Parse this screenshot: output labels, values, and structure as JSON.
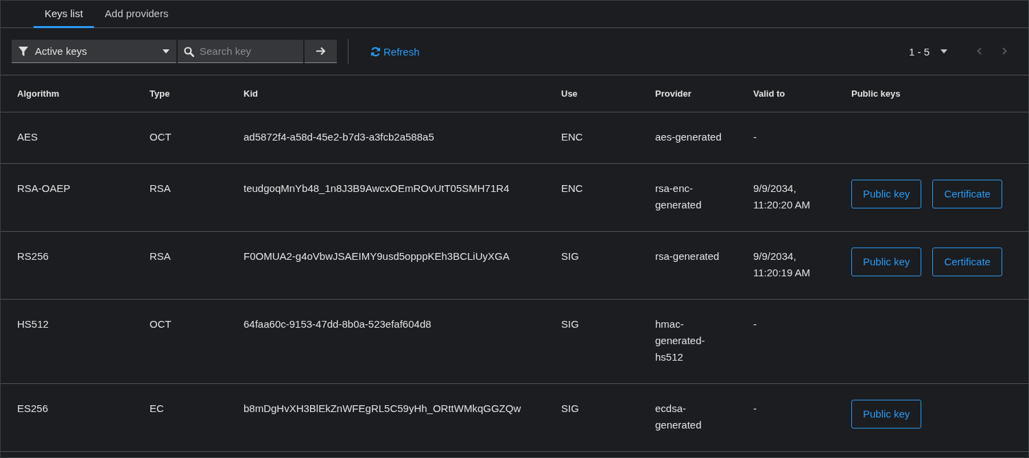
{
  "tabs": [
    {
      "label": "Keys list",
      "selected": true
    },
    {
      "label": "Add providers",
      "selected": false
    }
  ],
  "toolbar": {
    "filter": "Active keys",
    "search": {
      "placeholder": "Search key"
    },
    "refresh": "Refresh",
    "pagination": {
      "range": "1 - 5",
      "prev_disabled": true,
      "next_disabled": true
    }
  },
  "table": {
    "columns": [
      "Algorithm",
      "Type",
      "Kid",
      "Use",
      "Provider",
      "Valid to",
      "Public keys"
    ],
    "rows": [
      {
        "algorithm": "AES",
        "type": "OCT",
        "kid": "ad5872f4-a58d-45e2-b7d3-a3fcb2a588a5",
        "use": "ENC",
        "provider": "aes-generated",
        "valid_to": "-",
        "public_keys": []
      },
      {
        "algorithm": "RSA-OAEP",
        "type": "RSA",
        "kid": "teudgoqMnYb48_1n8J3B9AwcxOEmROvUtT05SMH71R4",
        "use": "ENC",
        "provider": "rsa-enc-generated",
        "valid_to": "9/9/2034, 11:20:20 AM",
        "public_keys": [
          "Public key",
          "Certificate"
        ]
      },
      {
        "algorithm": "RS256",
        "type": "RSA",
        "kid": "F0OMUA2-g4oVbwJSAEIMY9usd5opppKEh3BCLiUyXGA",
        "use": "SIG",
        "provider": "rsa-generated",
        "valid_to": "9/9/2034, 11:20:19 AM",
        "public_keys": [
          "Public key",
          "Certificate"
        ]
      },
      {
        "algorithm": "HS512",
        "type": "OCT",
        "kid": "64faa60c-9153-47dd-8b0a-523efaf604d8",
        "use": "SIG",
        "provider": "hmac-generated-hs512",
        "valid_to": "-",
        "public_keys": []
      },
      {
        "algorithm": "ES256",
        "type": "EC",
        "kid": "b8mDgHvXH3BlEkZnWFEgRL5C59yHh_ORttWMkqGGZQw",
        "use": "SIG",
        "provider": "ecdsa-generated",
        "valid_to": "-",
        "public_keys": [
          "Public key"
        ]
      }
    ]
  }
}
